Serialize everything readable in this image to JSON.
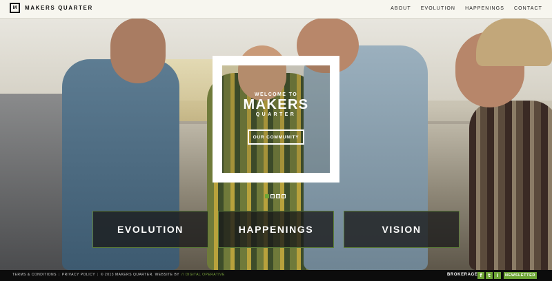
{
  "header": {
    "logo_mark": "M",
    "logo_text": "MAKERS QUARTER",
    "nav": [
      "ABOUT",
      "EVOLUTION",
      "HAPPENINGS",
      "CONTACT"
    ]
  },
  "welcome": {
    "line1": "WELCOME TO",
    "brand": "MAKERS",
    "brand_sub": "QUARTER",
    "button": "OUR COMMUNITY"
  },
  "slider": {
    "count": 4,
    "active_index": 0
  },
  "tiles": [
    "EVOLUTION",
    "HAPPENINGS",
    "VISION"
  ],
  "footer": {
    "terms": "TERMS & CONDITIONS",
    "privacy": "PRIVACY POLICY",
    "copyright": "© 2013 MAKERS QUARTER. WEBSITE BY",
    "credit": "// DIGITAL OPERATIVE",
    "brokerage": "BROKERAGE",
    "social": [
      "f",
      "t",
      "i"
    ],
    "social_icons": [
      "facebook-icon",
      "twitter-icon",
      "instagram-icon"
    ],
    "newsletter": "NEWSLETTER"
  },
  "colors": {
    "accent_green": "#6da435",
    "header_bg": "#f7f6ef",
    "footer_bg": "#0c0c0c"
  }
}
